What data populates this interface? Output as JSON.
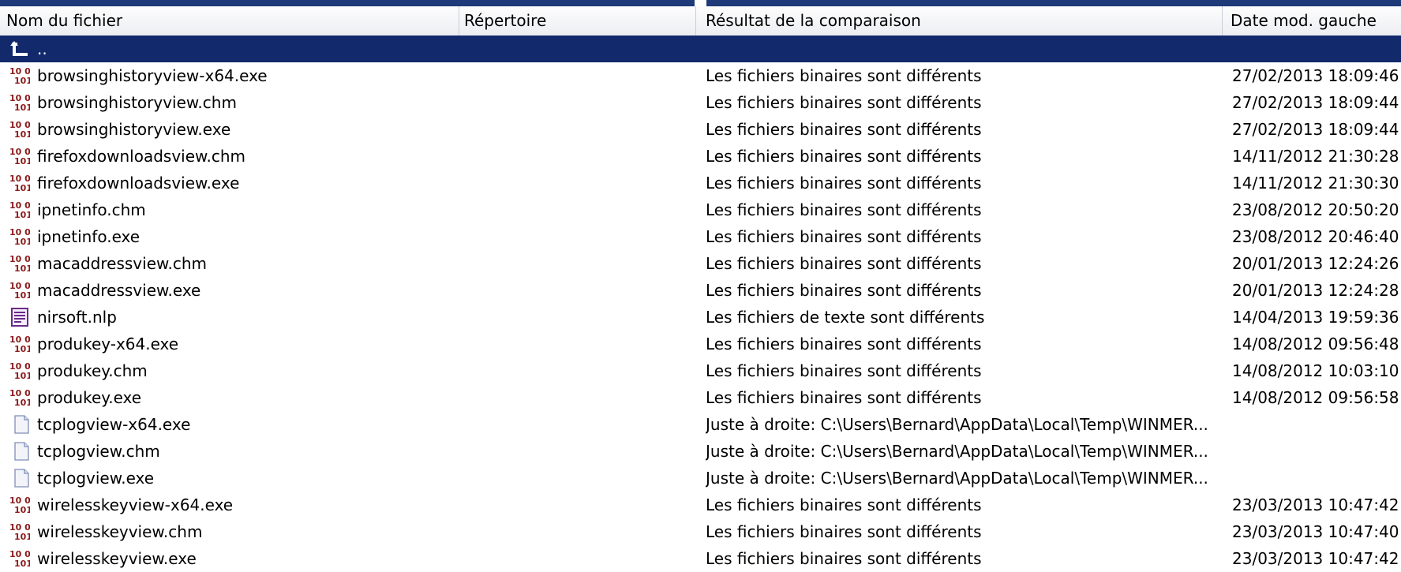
{
  "columns": {
    "name": "Nom du fichier",
    "directory": "Répertoire",
    "result": "Résultat de la comparaison",
    "date": "Date mod. gauche"
  },
  "parent_row": {
    "label": "..",
    "icon": "parent-folder-arrow-icon"
  },
  "rows": [
    {
      "name": "browsinghistoryview-x64.exe",
      "icon": "binary-file-icon",
      "result": "Les fichiers binaires sont différents",
      "date": "27/02/2013 18:09:46"
    },
    {
      "name": "browsinghistoryview.chm",
      "icon": "binary-file-icon",
      "result": "Les fichiers binaires sont différents",
      "date": "27/02/2013 18:09:44"
    },
    {
      "name": "browsinghistoryview.exe",
      "icon": "binary-file-icon",
      "result": "Les fichiers binaires sont différents",
      "date": "27/02/2013 18:09:44"
    },
    {
      "name": "firefoxdownloadsview.chm",
      "icon": "binary-file-icon",
      "result": "Les fichiers binaires sont différents",
      "date": "14/11/2012 21:30:28"
    },
    {
      "name": "firefoxdownloadsview.exe",
      "icon": "binary-file-icon",
      "result": "Les fichiers binaires sont différents",
      "date": "14/11/2012 21:30:30"
    },
    {
      "name": "ipnetinfo.chm",
      "icon": "binary-file-icon",
      "result": "Les fichiers binaires sont différents",
      "date": "23/08/2012 20:50:20"
    },
    {
      "name": "ipnetinfo.exe",
      "icon": "binary-file-icon",
      "result": "Les fichiers binaires sont différents",
      "date": "23/08/2012 20:46:40"
    },
    {
      "name": "macaddressview.chm",
      "icon": "binary-file-icon",
      "result": "Les fichiers binaires sont différents",
      "date": "20/01/2013 12:24:26"
    },
    {
      "name": "macaddressview.exe",
      "icon": "binary-file-icon",
      "result": "Les fichiers binaires sont différents",
      "date": "20/01/2013 12:24:28"
    },
    {
      "name": "nirsoft.nlp",
      "icon": "text-file-icon",
      "result": "Les fichiers de texte sont différents",
      "date": "14/04/2013 19:59:36"
    },
    {
      "name": "produkey-x64.exe",
      "icon": "binary-file-icon",
      "result": "Les fichiers binaires sont différents",
      "date": "14/08/2012 09:56:48"
    },
    {
      "name": "produkey.chm",
      "icon": "binary-file-icon",
      "result": "Les fichiers binaires sont différents",
      "date": "14/08/2012 10:03:10"
    },
    {
      "name": "produkey.exe",
      "icon": "binary-file-icon",
      "result": "Les fichiers binaires sont différents",
      "date": "14/08/2012 09:56:58"
    },
    {
      "name": "tcplogview-x64.exe",
      "icon": "right-only-file-icon",
      "result": "Juste à droite: C:\\Users\\Bernard\\AppData\\Local\\Temp\\WINMER...",
      "date": ""
    },
    {
      "name": "tcplogview.chm",
      "icon": "right-only-file-icon",
      "result": "Juste à droite: C:\\Users\\Bernard\\AppData\\Local\\Temp\\WINMER...",
      "date": ""
    },
    {
      "name": "tcplogview.exe",
      "icon": "right-only-file-icon",
      "result": "Juste à droite: C:\\Users\\Bernard\\AppData\\Local\\Temp\\WINMER...",
      "date": ""
    },
    {
      "name": "wirelesskeyview-x64.exe",
      "icon": "binary-file-icon",
      "result": "Les fichiers binaires sont différents",
      "date": "23/03/2013 10:47:42"
    },
    {
      "name": "wirelesskeyview.chm",
      "icon": "binary-file-icon",
      "result": "Les fichiers binaires sont différents",
      "date": "23/03/2013 10:47:40"
    },
    {
      "name": "wirelesskeyview.exe",
      "icon": "binary-file-icon",
      "result": "Les fichiers binaires sont différents",
      "date": "23/03/2013 10:47:42"
    }
  ],
  "colors": {
    "selection": "#12296b",
    "header_border": "#c9cfd8",
    "binary_icon": "#8b1a1a"
  }
}
